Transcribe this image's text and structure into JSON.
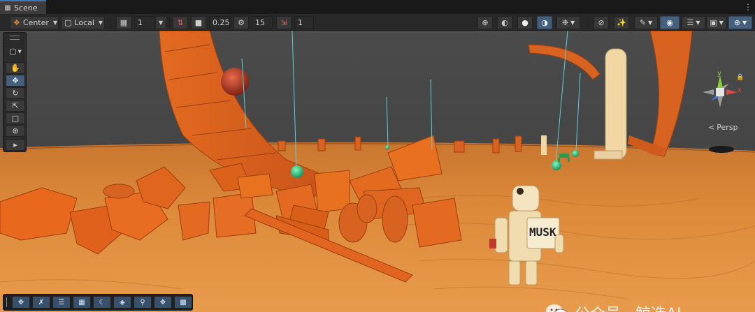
{
  "tab": {
    "title": "Scene",
    "icon": "scene-grid-icon"
  },
  "toolbar": {
    "pivot_mode": "Center",
    "pivot_rotation": "Local",
    "grid_size_value": "1",
    "snap_move_value": "0.25",
    "snap_rotate_value": "15",
    "snap_scale_value": "1",
    "icons": {
      "pivot": "pivot-center-icon",
      "rotation": "local-cube-icon",
      "grid": "grid-snap-icon",
      "snap_move": "move-snap-icon",
      "snap_scale_size": "scale-snap-icon",
      "snap_rotate": "rotate-snap-icon",
      "snap_increment": "increment-snap-icon",
      "draw_wire": "wireframe-sphere-icon",
      "draw_shaded_wire": "shaded-wire-sphere-icon",
      "draw_unlit": "unlit-sphere-icon",
      "draw_shaded": "shaded-sphere-icon",
      "debug": "bug-icon",
      "toggle_2d": "2d-toggle-icon",
      "lighting": "lighting-icon",
      "effects": "effects-wand-icon",
      "visibility": "eye-icon",
      "layers": "layers-icon",
      "camera": "camera-icon",
      "gizmos": "gizmo-globe-icon"
    }
  },
  "tools": [
    {
      "name": "view-tool",
      "icon": "hand-icon",
      "active": false
    },
    {
      "name": "move-tool",
      "icon": "move-arrows-icon",
      "active": true
    },
    {
      "name": "rotate-tool",
      "icon": "rotate-icon",
      "active": false
    },
    {
      "name": "scale-tool",
      "icon": "scale-icon",
      "active": false
    },
    {
      "name": "rect-tool",
      "icon": "rect-icon",
      "active": false
    },
    {
      "name": "transform-tool",
      "icon": "transform-icon",
      "active": false
    },
    {
      "name": "custom-tool",
      "icon": "custom-tool-icon",
      "active": false
    }
  ],
  "gizmo": {
    "persp_label": "Persp",
    "axes": {
      "y": "y",
      "x": "x"
    },
    "y_color": "#8ccf3a",
    "x_color": "#d94a48",
    "z_color": "#3b78d0"
  },
  "bottom_tools": [
    {
      "name": "move-overlay",
      "icon": "move-arrows-icon"
    },
    {
      "name": "rotate-overlay",
      "icon": "compass-icon"
    },
    {
      "name": "sliders-overlay",
      "icon": "sliders-icon"
    },
    {
      "name": "grid-overlay",
      "icon": "grid-icon"
    },
    {
      "name": "moon-overlay",
      "icon": "moon-icon"
    },
    {
      "name": "plane-overlay",
      "icon": "plane-icon"
    },
    {
      "name": "search-overlay",
      "icon": "search-icon"
    },
    {
      "name": "pan-overlay",
      "icon": "move-arrows-icon"
    },
    {
      "name": "screen-overlay",
      "icon": "screen-camera-icon"
    }
  ],
  "scene": {
    "robot_label": "MUSK",
    "sand_color": "#d27a2c",
    "sky_color": "#4a4a4a",
    "block_color": "#e0661f"
  },
  "watermark": {
    "text": "公众号 · 鲸选AI",
    "icon": "wechat-logo-icon"
  }
}
